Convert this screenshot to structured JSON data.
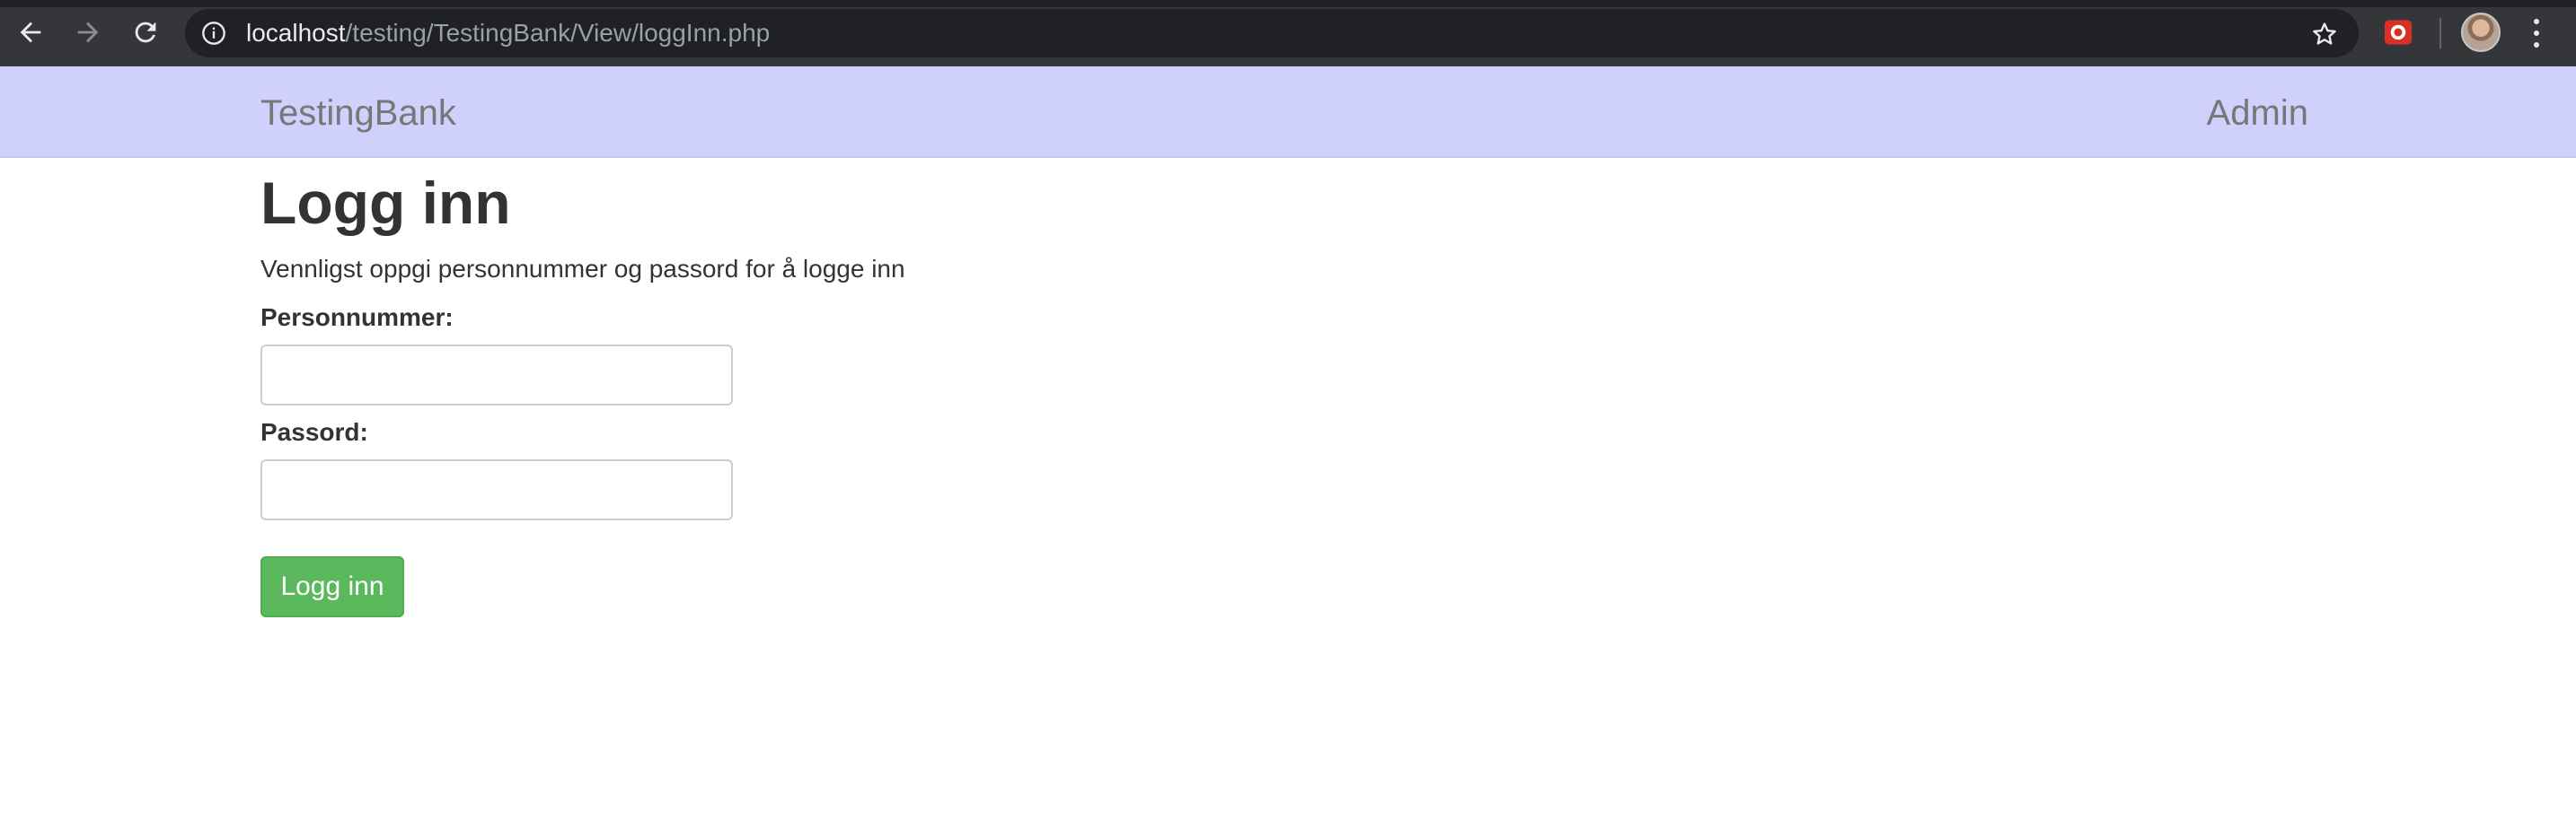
{
  "browser": {
    "url_host": "localhost",
    "url_path": "/testing/TestingBank/View/loggInn.php"
  },
  "navbar": {
    "brand": "TestingBank",
    "admin_link": "Admin"
  },
  "main": {
    "title": "Logg inn",
    "instructions": "Vennligst oppgi personnummer og passord for å logge inn",
    "personnummer_label": "Personnummer:",
    "personnummer_value": "",
    "passord_label": "Passord:",
    "passord_value": "",
    "submit_label": "Logg inn"
  },
  "colors": {
    "navbar_bg": "#cfd0fb",
    "button_green": "#5cb85c",
    "chrome_bg": "#35363a"
  }
}
